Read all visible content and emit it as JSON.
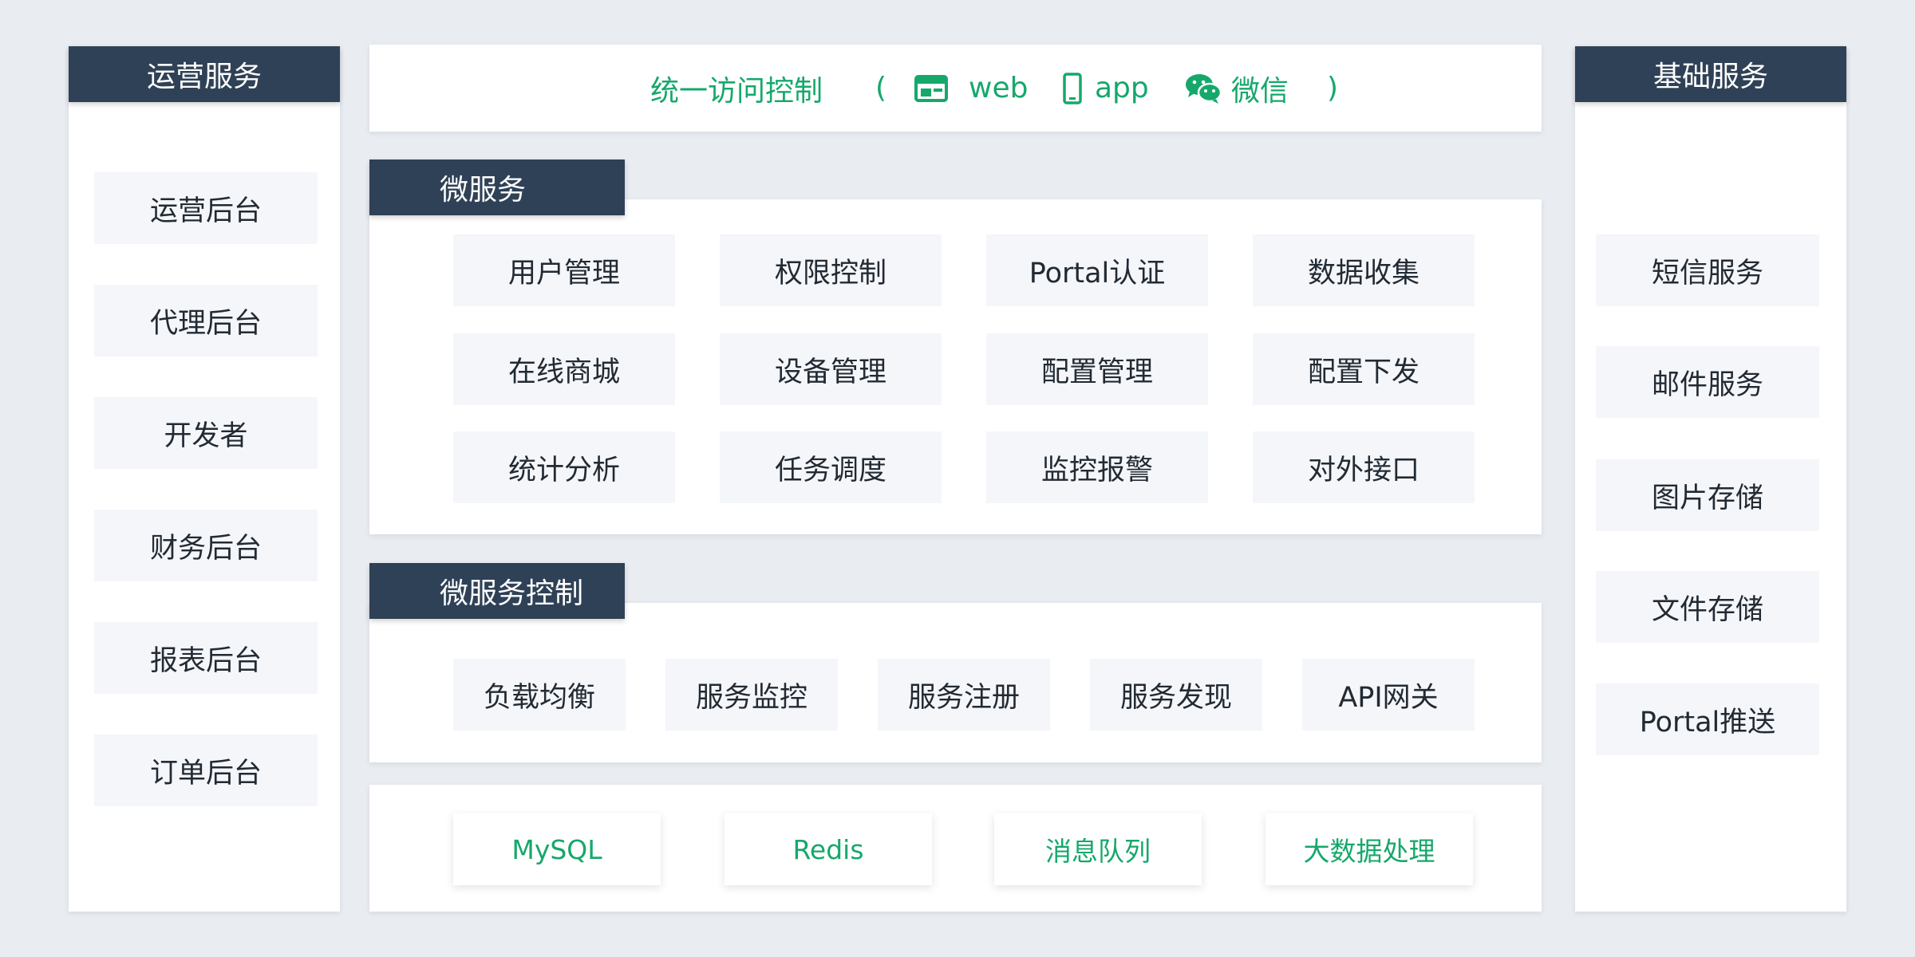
{
  "colors": {
    "header_bg": "#2f4156",
    "accent_green": "#16a86b",
    "tile_bg": "#f4f6fa",
    "page_bg": "#e9ecf1"
  },
  "left_column": {
    "title": "运营服务",
    "items": [
      "运营后台",
      "代理后台",
      "开发者",
      "财务后台",
      "报表后台",
      "订单后台"
    ]
  },
  "right_column": {
    "title": "基础服务",
    "items": [
      "短信服务",
      "邮件服务",
      "图片存储",
      "文件存储",
      "Portal推送"
    ]
  },
  "access_bar": {
    "title": "统一访问控制",
    "open_paren": "(",
    "close_paren": ")",
    "channels": [
      {
        "icon": "browser-window-icon",
        "label": "web"
      },
      {
        "icon": "mobile-phone-icon",
        "label": "app"
      },
      {
        "icon": "wechat-icon",
        "label": "微信"
      }
    ]
  },
  "microservices": {
    "title": "微服务",
    "items": [
      "用户管理",
      "权限控制",
      "Portal认证",
      "数据收集",
      "在线商城",
      "设备管理",
      "配置管理",
      "配置下发",
      "统计分析",
      "任务调度",
      "监控报警",
      "对外接口"
    ]
  },
  "service_control": {
    "title": "微服务控制",
    "items": [
      "负载均衡",
      "服务监控",
      "服务注册",
      "服务发现",
      "API网关"
    ]
  },
  "storage": {
    "items": [
      "MySQL",
      "Redis",
      "消息队列",
      "大数据处理"
    ]
  }
}
